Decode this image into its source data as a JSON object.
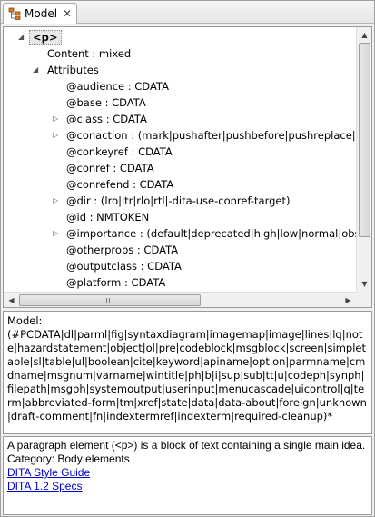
{
  "tab": {
    "title": "Model",
    "close": "✕",
    "icon": "model-tree-icon"
  },
  "tree": {
    "root": "<p>",
    "content_model": "Content : mixed",
    "attributes_label": "Attributes",
    "attributes": [
      {
        "text": "@audience : CDATA",
        "expandable": false
      },
      {
        "text": "@base : CDATA",
        "expandable": false
      },
      {
        "text": "@class : CDATA",
        "expandable": true
      },
      {
        "text": "@conaction : (mark|pushafter|pushbefore|pushreplace|-dita-",
        "expandable": true
      },
      {
        "text": "@conkeyref : CDATA",
        "expandable": false
      },
      {
        "text": "@conref : CDATA",
        "expandable": false
      },
      {
        "text": "@conrefend : CDATA",
        "expandable": false
      },
      {
        "text": "@dir : (lro|ltr|rlo|rtl|-dita-use-conref-target)",
        "expandable": true
      },
      {
        "text": "@id : NMTOKEN",
        "expandable": false
      },
      {
        "text": "@importance : (default|deprecated|high|low|normal|obsolete",
        "expandable": true
      },
      {
        "text": "@otherprops : CDATA",
        "expandable": false
      },
      {
        "text": "@outputclass : CDATA",
        "expandable": false
      },
      {
        "text": "@platform : CDATA",
        "expandable": false
      }
    ]
  },
  "model": {
    "label": "Model:",
    "text": "(#PCDATA|dl|parml|fig|syntaxdiagram|imagemap|image|lines|lq|note|hazardstatement|object|ol|pre|codeblock|msgblock|screen|simpletable|sl|table|ul|boolean|cite|keyword|apiname|option|parmname|cmdname|msgnum|varname|wintitle|ph|b|i|sup|sub|tt|u|codeph|synph|filepath|msgph|systemoutput|userinput|menucascade|uicontrol|q|term|abbreviated-form|tm|xref|state|data|data-about|foreign|unknown|draft-comment|fn|indextermref|indexterm|required-cleanup)*"
  },
  "doc": {
    "description": "A paragraph element (<p>) is a block of text containing a single main idea.",
    "category": "Category: Body elements",
    "links": [
      "DITA Style Guide",
      "DITA 1.2 Specs"
    ]
  }
}
